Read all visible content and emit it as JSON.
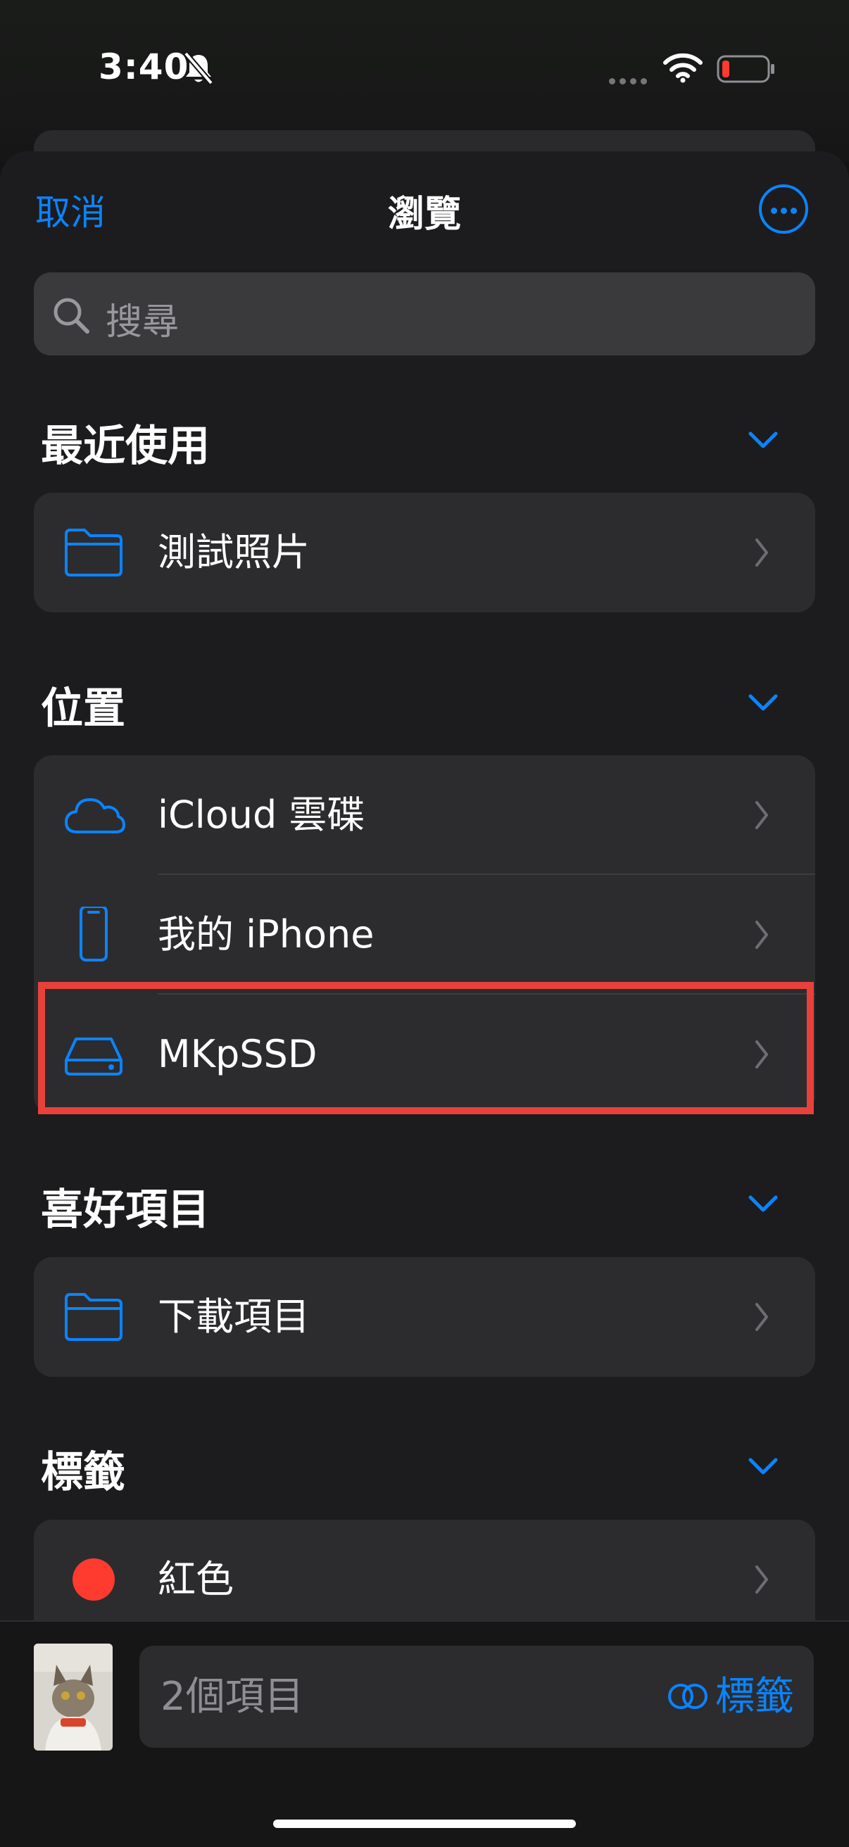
{
  "status_bar": {
    "time": "3:40"
  },
  "nav": {
    "cancel": "取消",
    "title": "瀏覽"
  },
  "search": {
    "placeholder": "搜尋"
  },
  "sections": {
    "recent": {
      "title": "最近使用",
      "items": [
        {
          "label": "測試照片",
          "icon": "folder-icon"
        }
      ]
    },
    "locations": {
      "title": "位置",
      "items": [
        {
          "label": "iCloud 雲碟",
          "icon": "cloud-icon"
        },
        {
          "label": "我的 iPhone",
          "icon": "iphone-icon"
        },
        {
          "label": "MKpSSD",
          "icon": "drive-icon"
        }
      ]
    },
    "favorites": {
      "title": "喜好項目",
      "items": [
        {
          "label": "下載項目",
          "icon": "folder-icon"
        }
      ]
    },
    "tags": {
      "title": "標籤",
      "items": [
        {
          "label": "紅色",
          "icon": "red-dot-icon",
          "color": "#ff3b30"
        }
      ]
    }
  },
  "toolbar": {
    "items_count": "2個項目",
    "tags_button": "標籤"
  },
  "colors": {
    "accent": "#0a84ff",
    "highlight": "#e8413b",
    "background": "#1c1c1e",
    "card": "#2c2c2e"
  }
}
